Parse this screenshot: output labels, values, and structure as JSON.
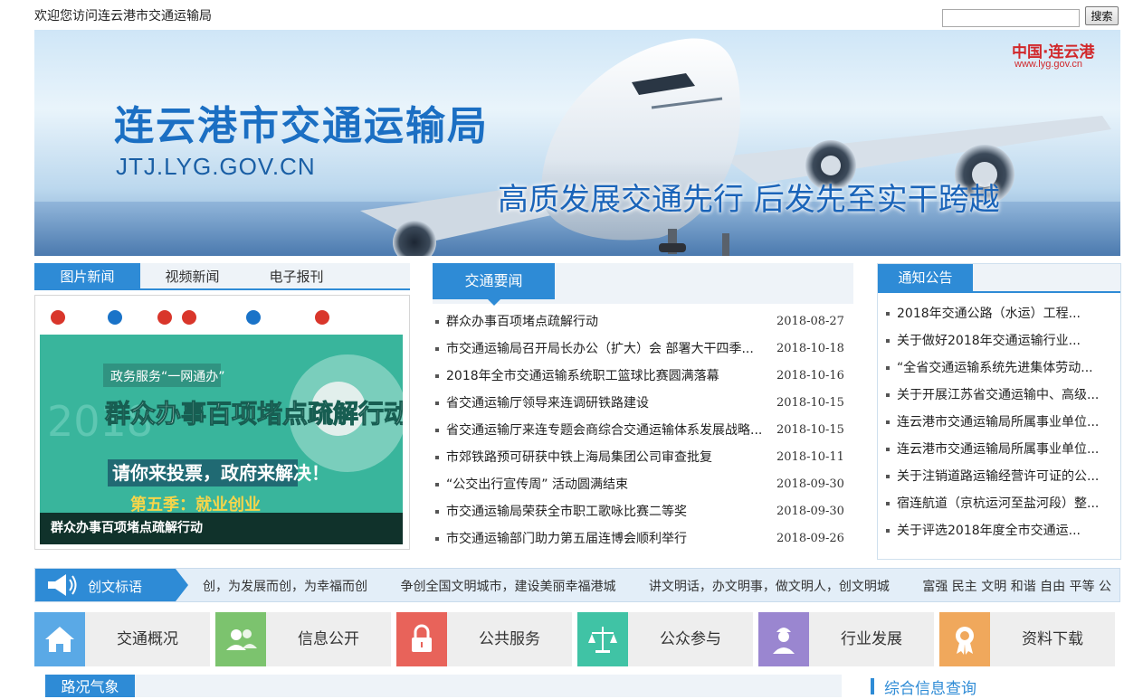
{
  "header": {
    "welcome": "欢迎您访问连云港市交通运输局",
    "search_placeholder": "",
    "search_button": "搜索"
  },
  "banner": {
    "title": "连云港市交通运输局",
    "url": "JTJ.LYG.GOV.CN",
    "slogan": "高质发展交通先行  后发先至实干跨越",
    "logo": "中国·连云港",
    "logo_url": "www.lyg.gov.cn"
  },
  "left_tabs": [
    "图片新闻",
    "视频新闻",
    "电子报刊"
  ],
  "photo_caption": "群众办事百项堵点疏解行动",
  "photo_art": {
    "year": "2018",
    "banner_top": "政务服务“一网通办”",
    "line1": "群众办事百项堵点疏解行动",
    "line2": "请你来投票，政府来解决！",
    "line3": "第五季：就业创业"
  },
  "news": {
    "tab": "交通要闻",
    "items": [
      {
        "title": "群众办事百项堵点疏解行动",
        "date": "2018-08-27"
      },
      {
        "title": "市交通运输局召开局长办公（扩大）会 部署大干四季...",
        "date": "2018-10-18"
      },
      {
        "title": "2018年全市交通运输系统职工篮球比赛圆满落幕",
        "date": "2018-10-16"
      },
      {
        "title": "省交通运输厅领导来连调研铁路建设",
        "date": "2018-10-15"
      },
      {
        "title": "省交通运输厅来连专题会商综合交通运输体系发展战略...",
        "date": "2018-10-15"
      },
      {
        "title": "市郊铁路预可研获中铁上海局集团公司审查批复",
        "date": "2018-10-11"
      },
      {
        "title": "“公交出行宣传周” 活动圆满结束",
        "date": "2018-09-30"
      },
      {
        "title": "市交通运输局荣获全市职工歌咏比赛二等奖",
        "date": "2018-09-30"
      },
      {
        "title": "市交通运输部门助力第五届连博会顺利举行",
        "date": "2018-09-26"
      }
    ]
  },
  "notice": {
    "tab": "通知公告",
    "items": [
      "2018年交通公路（水运）工程...",
      "关于做好2018年交通运输行业...",
      "“全省交通运输系统先进集体劳动...",
      "关于开展江苏省交通运输中、高级...",
      "连云港市交通运输局所属事业单位...",
      "连云港市交通运输局所属事业单位...",
      "关于注销道路运输经营许可证的公...",
      "宿连航道（京杭运河至盐河段）整...",
      "关于评选2018年度全市交通运..."
    ]
  },
  "slogans": {
    "label": "创文标语",
    "items": [
      "创，为发展而创，为幸福而创",
      "争创全国文明城市，建设美丽幸福港城",
      "讲文明话，办文明事，做文明人，创文明城",
      "富强 民主 文明 和谐 自由 平等 公"
    ]
  },
  "quick_links": [
    {
      "label": "交通概况",
      "color": "#5aa9e6",
      "icon": "home-icon"
    },
    {
      "label": "信息公开",
      "color": "#7cc36e",
      "icon": "users-icon"
    },
    {
      "label": "公共服务",
      "color": "#e8635a",
      "icon": "lock-icon"
    },
    {
      "label": "公众参与",
      "color": "#40c3a5",
      "icon": "scale-icon"
    },
    {
      "label": "行业发展",
      "color": "#9a86d0",
      "icon": "worker-icon"
    },
    {
      "label": "资料下载",
      "color": "#f0a85c",
      "icon": "award-icon"
    }
  ],
  "bottom": {
    "left_tab": "路况气象",
    "right_title": "综合信息查询"
  }
}
